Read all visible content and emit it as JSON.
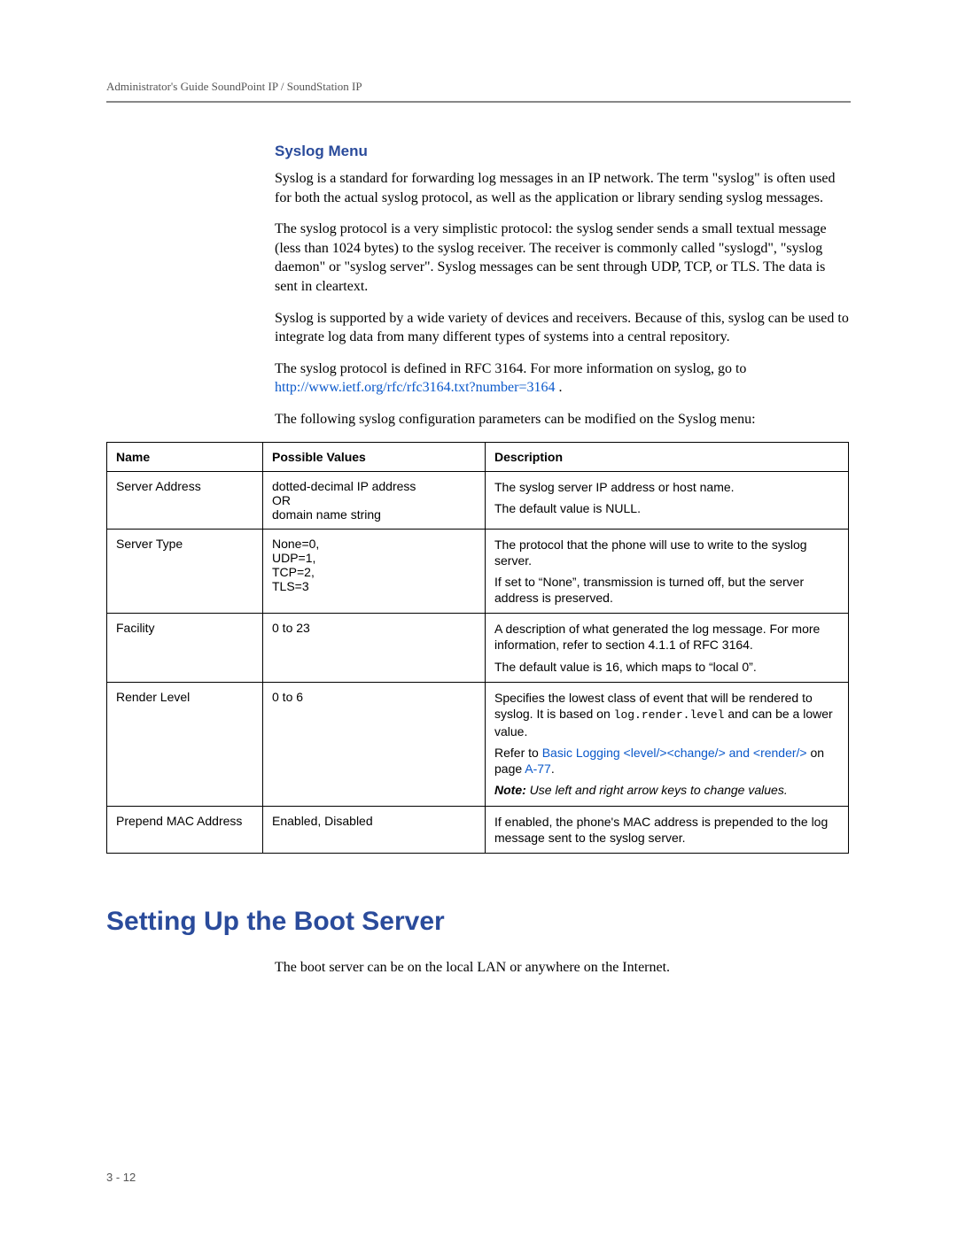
{
  "running_header": "Administrator's Guide SoundPoint IP / SoundStation IP",
  "syslog": {
    "heading": "Syslog Menu",
    "p1": "Syslog is a standard for forwarding log messages in an IP network. The term \"syslog\" is often used for both the actual syslog protocol, as well as the application or library sending syslog messages.",
    "p2": "The syslog protocol is a very simplistic protocol: the syslog sender sends a small textual message (less than 1024 bytes) to the syslog receiver. The receiver is commonly called \"syslogd\", \"syslog daemon\" or \"syslog server\". Syslog messages can be sent through UDP, TCP, or TLS. The data is sent in cleartext.",
    "p3": "Syslog is supported by a wide variety of devices and receivers. Because of this, syslog can be used to integrate log data from many different types of systems into a central repository.",
    "p4_pre": "The syslog protocol is defined in RFC 3164. For more information on syslog, go to ",
    "p4_link": "http://www.ietf.org/rfc/rfc3164.txt?number=3164",
    "p4_post": " .",
    "p5": "The following syslog configuration parameters can be modified on the Syslog menu:"
  },
  "table": {
    "headers": {
      "c1": "Name",
      "c2": "Possible Values",
      "c3": "Description"
    },
    "rows": [
      {
        "name": "Server Address",
        "values": "dotted-decimal IP address\nOR\ndomain name string",
        "desc_parts": [
          {
            "t": "The syslog server IP address or host name."
          },
          {
            "t": "The default value is NULL."
          }
        ]
      },
      {
        "name": "Server Type",
        "values": "None=0,\nUDP=1,\nTCP=2,\nTLS=3",
        "desc_parts": [
          {
            "t": "The protocol that the phone will use to write to the syslog server."
          },
          {
            "t": "If set to “None”, transmission is turned off, but the server address is preserved."
          }
        ]
      },
      {
        "name": "Facility",
        "values": "0 to 23",
        "desc_parts": [
          {
            "t": "A description of what generated the log message. For more information, refer to section 4.1.1 of RFC 3164."
          },
          {
            "t": "The default value is 16, which maps to “local 0”."
          }
        ]
      },
      {
        "name": "Render Level",
        "values": "0 to 6",
        "render": {
          "sent1_pre": "Specifies the lowest class of event that will be rendered to syslog. It is based on ",
          "sent1_code": "log.render.level",
          "sent1_post": " and can be a lower value.",
          "sent2_pre": "Refer to ",
          "sent2_link": "Basic Logging <level/><change/> and <render/>",
          "sent2_mid": " on page ",
          "sent2_page": "A-77",
          "sent2_post": ".",
          "note_label": "Note:",
          "note_text": " Use left and right arrow keys to change values."
        }
      },
      {
        "name": "Prepend MAC Address",
        "values": "Enabled, Disabled",
        "desc_parts": [
          {
            "t": "If enabled, the phone's MAC address is prepended to the log message sent to the syslog server."
          }
        ]
      }
    ]
  },
  "boot": {
    "heading": "Setting Up the Boot Server",
    "p1": "The boot server can be on the local LAN or anywhere on the Internet."
  },
  "page_number": "3 - 12"
}
